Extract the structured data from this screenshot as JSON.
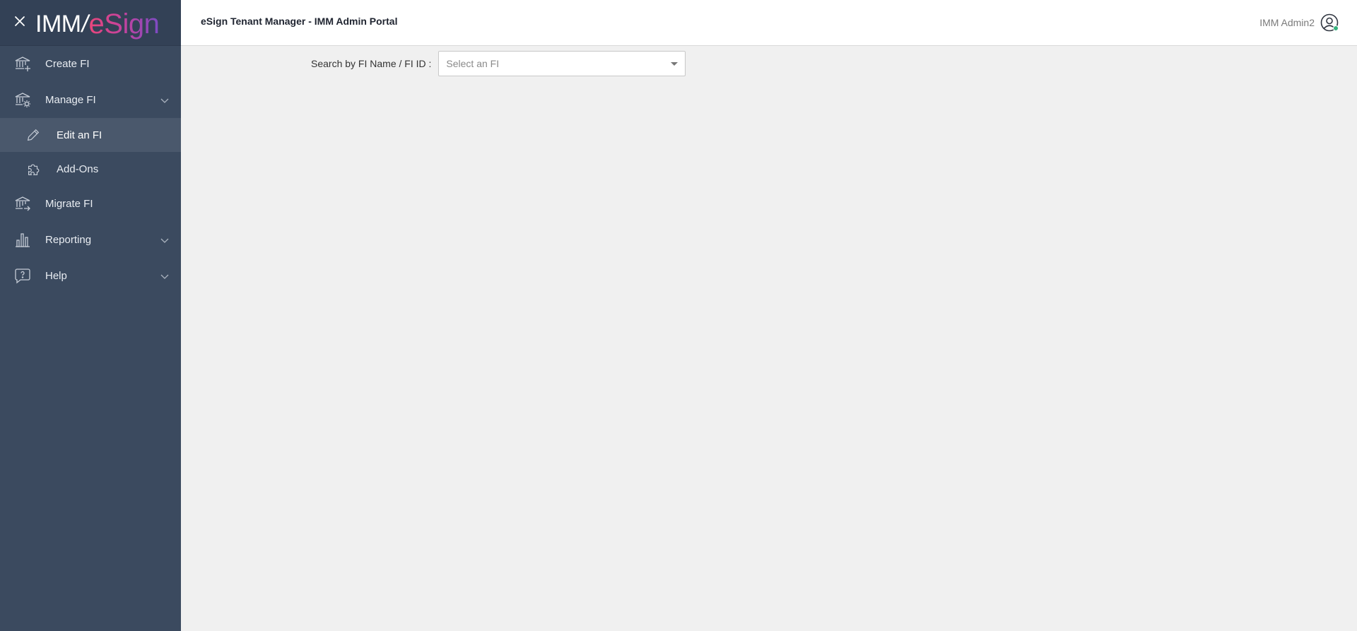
{
  "brand": {
    "logo_left": "IMM",
    "logo_right": "eSign"
  },
  "header": {
    "title": "eSign Tenant Manager - IMM Admin Portal",
    "user_name": "IMM Admin2"
  },
  "sidebar": {
    "items": [
      {
        "label": "Create FI",
        "icon": "bank-plus-icon"
      },
      {
        "label": "Manage FI",
        "icon": "bank-gear-icon",
        "expanded": true,
        "children": [
          {
            "label": "Edit an FI",
            "icon": "pencil-icon",
            "active": true
          },
          {
            "label": "Add-Ons",
            "icon": "puzzle-icon"
          }
        ]
      },
      {
        "label": "Migrate FI",
        "icon": "bank-arrow-icon"
      },
      {
        "label": "Reporting",
        "icon": "bar-chart-icon"
      },
      {
        "label": "Help",
        "icon": "help-chat-icon"
      }
    ]
  },
  "main": {
    "search_label": "Search by FI Name / FI ID :",
    "fi_select": {
      "placeholder": "Select an FI",
      "value": ""
    }
  },
  "colors": {
    "sidebar": "#3b4a5f",
    "active_item": "#4a586c",
    "background": "#f0f0f0"
  }
}
